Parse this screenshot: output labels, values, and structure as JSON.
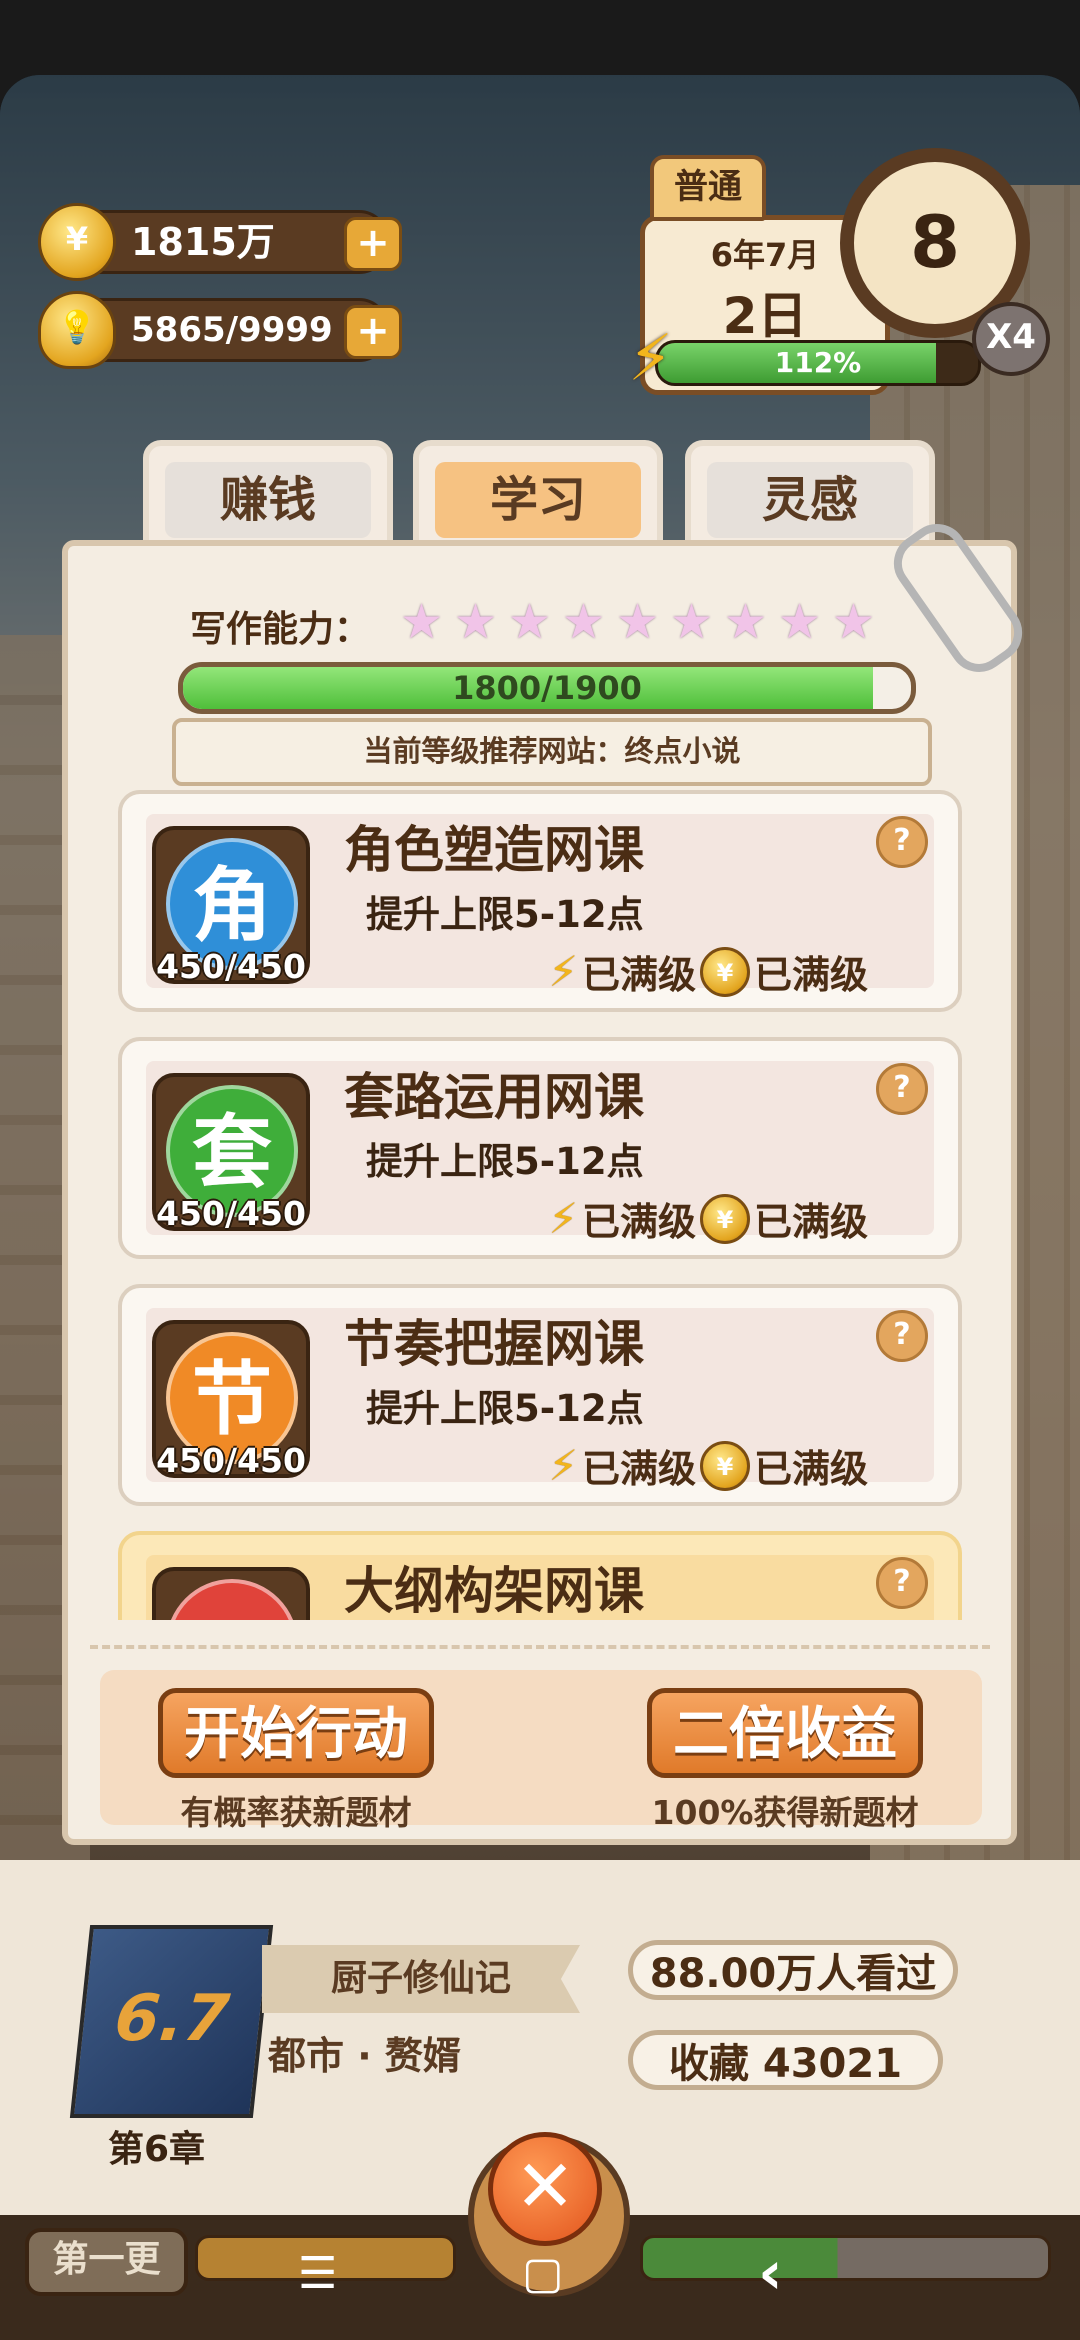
{
  "hud": {
    "coins": "1815万",
    "bulbs": "5865/9999",
    "plus_symbol": "+",
    "mode": "普通",
    "date_month": "6年7月",
    "date_day": "2日",
    "clock_value": "8",
    "multiplier": "X4",
    "energy_percent_text": "112%",
    "energy_fill": 0.87
  },
  "tabs": [
    {
      "label": "赚钱",
      "active": false
    },
    {
      "label": "学习",
      "active": true
    },
    {
      "label": "灵感",
      "active": false
    }
  ],
  "skill": {
    "label": "写作能力：",
    "stars": 9,
    "progress_text": "1800/1900",
    "progress_value": 1800,
    "progress_max": 1900,
    "recommend": "当前等级推荐网站：终点小说"
  },
  "courses": [
    {
      "icon_char": "角",
      "color": "#2f8fd8",
      "count": "450/450",
      "title": "角色塑造网课",
      "desc": "提升上限5-12点",
      "energy_status": "已满级",
      "coin_status": "已满级",
      "help": "?"
    },
    {
      "icon_char": "套",
      "color": "#3fae3a",
      "count": "450/450",
      "title": "套路运用网课",
      "desc": "提升上限5-12点",
      "energy_status": "已满级",
      "coin_status": "已满级",
      "help": "?"
    },
    {
      "icon_char": "节",
      "color": "#f08a26",
      "count": "450/450",
      "title": "节奏把握网课",
      "desc": "提升上限5-12点",
      "energy_status": "已满级",
      "coin_status": "已满级",
      "help": "?"
    },
    {
      "icon_char": "",
      "color": "#e0433a",
      "count": "",
      "title": "大纲构架网课",
      "desc": "",
      "energy_status": "",
      "coin_status": "",
      "help": "?"
    }
  ],
  "actions": {
    "start_label": "开始行动",
    "start_sub": "有概率获新题材",
    "double_label": "二倍收益",
    "double_sub": "100%获得新题材"
  },
  "book": {
    "rating": "6.7",
    "chapter": "第6章",
    "name": "厨子修仙记",
    "genre": "都市 · 赘婿",
    "views": "88.00万人看过",
    "favorites": "收藏  43021",
    "first_update": "第一更"
  },
  "close_symbol": "✕",
  "nav": {
    "menu": "☰",
    "home": "▢",
    "back": "‹"
  }
}
